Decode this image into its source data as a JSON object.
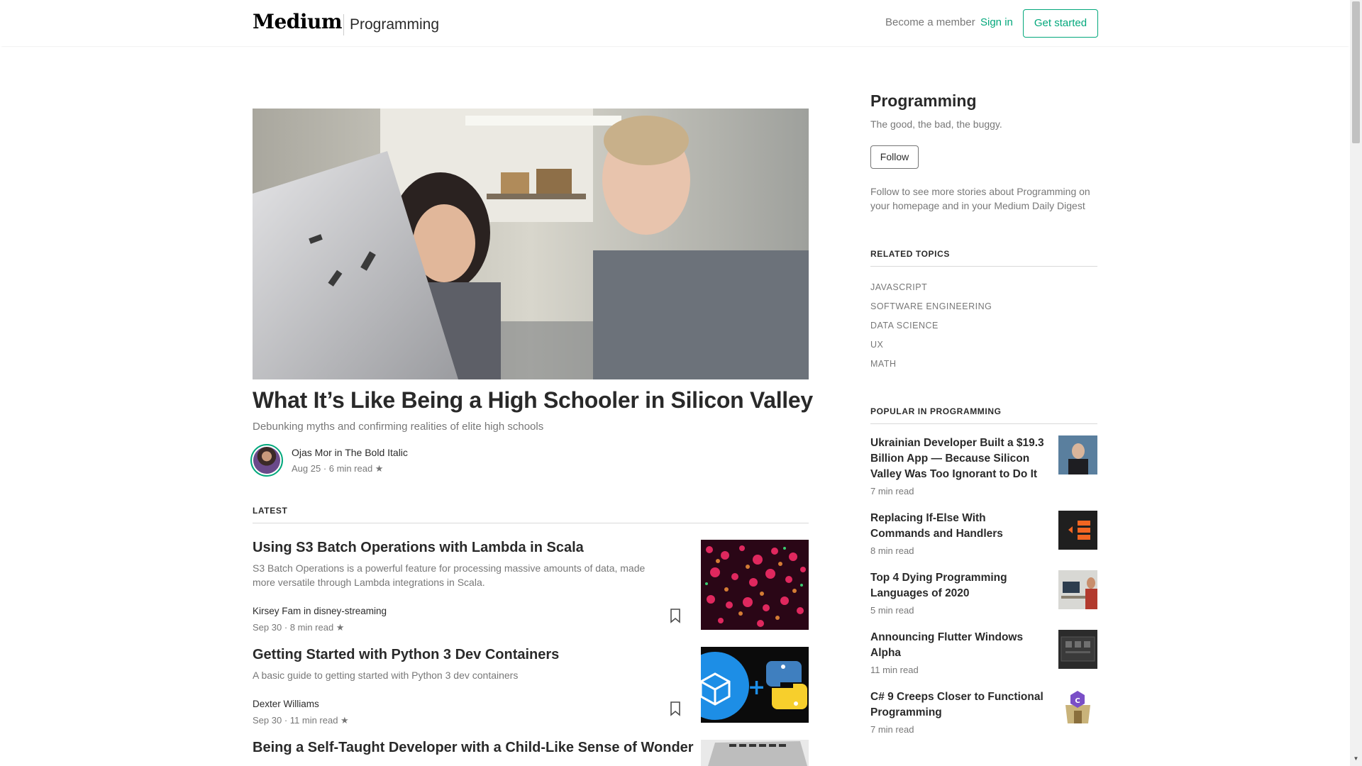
{
  "header": {
    "logo": "Medium",
    "section": "Programming",
    "become_member": "Become a member",
    "sign_in": "Sign in",
    "get_started": "Get started"
  },
  "hero": {
    "title": "What It’s Like Being a High Schooler in Silicon Valley",
    "subtitle": "Debunking myths and confirming realities of elite high schools",
    "author": "Ojas Mor in The Bold Italic",
    "meta": "Aug 25 · 6 min read ★"
  },
  "latest": {
    "label": "LATEST",
    "posts": [
      {
        "title": "Using S3 Batch Operations with Lambda in Scala",
        "excerpt": "S3 Batch Operations is a powerful feature for processing massive amounts of data, made more versatile through Lambda integrations in Scala.",
        "author": "Kirsey Fam in disney-streaming",
        "meta": "Sep 30 · 8 min read ★"
      },
      {
        "title": "Getting Started with Python 3 Dev Containers",
        "excerpt": "A basic guide to getting started with Python 3 dev containers",
        "author": "Dexter Williams",
        "meta": "Sep 30 · 11 min read ★"
      },
      {
        "title": "Being a Self-Taught Developer with a Child-Like Sense of Wonder"
      }
    ]
  },
  "sidebar": {
    "title": "Programming",
    "tagline": "The good, the bad, the buggy.",
    "follow": "Follow",
    "note": "Follow to see more stories about Programming on your homepage and in your Medium Daily Digest",
    "related_heading": "RELATED TOPICS",
    "related": [
      "JAVASCRIPT",
      "SOFTWARE ENGINEERING",
      "DATA SCIENCE",
      "UX",
      "MATH"
    ],
    "popular_heading": "POPULAR IN PROGRAMMING",
    "popular": [
      {
        "title": "Ukrainian Developer Built a $19.3 Billion App — Because Silicon Valley Was Too Ignorant to Do It",
        "meta": "7 min read"
      },
      {
        "title": "Replacing If-Else With Commands and Handlers",
        "meta": "8 min read"
      },
      {
        "title": "Top 4 Dying Programming Languages of 2020",
        "meta": "5 min read"
      },
      {
        "title": "Announcing Flutter Windows Alpha",
        "meta": "11 min read"
      },
      {
        "title": "C# 9 Creeps Closer to Functional Programming",
        "meta": "7 min read"
      }
    ]
  },
  "colors": {
    "accent": "#03a87c",
    "text_primary": "rgba(0,0,0,0.84)",
    "text_secondary": "rgba(0,0,0,0.54)"
  },
  "icons": [
    "bookmark-icon",
    "star-icon",
    "scroll-down-arrow-icon"
  ]
}
